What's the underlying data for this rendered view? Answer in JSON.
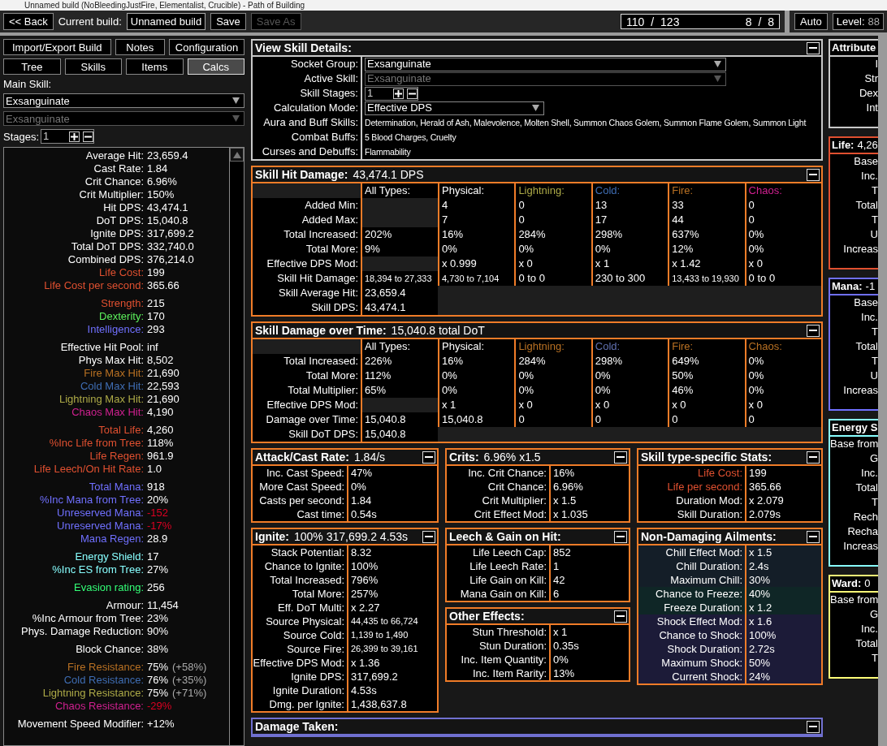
{
  "window": {
    "title": "Unnamed build (NoBleedingJustFire, Elementalist, Crucible) - Path of Building"
  },
  "top_bar": {
    "back": "<< Back",
    "current_build_label": "Current build:",
    "build_name": "Unnamed build",
    "save": "Save",
    "save_as": {
      "label": "Save As",
      "disabled": true
    },
    "points": "110 / 123",
    "ascendancy_points": "8 / 8",
    "auto": "Auto",
    "level_label": "Level:",
    "level": "88"
  },
  "left": {
    "buttons": [
      "Import/Export Build",
      "Notes",
      "Configuration"
    ],
    "tabs": [
      {
        "label": "Tree",
        "selected": false
      },
      {
        "label": "Skills",
        "selected": false
      },
      {
        "label": "Items",
        "selected": false
      },
      {
        "label": "Calcs",
        "selected": true
      }
    ],
    "main_skill_label": "Main Skill:",
    "selects": [
      {
        "value": "Exsanguinate",
        "disabled": false
      },
      {
        "value": "Exsanguinate",
        "disabled": true
      }
    ],
    "stages_label": "Stages:",
    "stages": "1",
    "stat_groups": [
      [
        {
          "label": "Average Hit:",
          "value": "23,659.4"
        },
        {
          "label": "Cast Rate:",
          "value": "1.84"
        },
        {
          "label": "Crit Chance:",
          "value": "6.96%"
        },
        {
          "label": "Crit Multiplier:",
          "value": "150%"
        },
        {
          "label": "Hit DPS:",
          "value": "43,474.1"
        },
        {
          "label": "DoT DPS:",
          "value": "15,040.8"
        },
        {
          "label": "Ignite DPS:",
          "value": "317,699.2"
        },
        {
          "label": "Total DoT DPS:",
          "value": "332,740.0"
        },
        {
          "label": "Combined DPS:",
          "value": "376,214.0"
        },
        {
          "label": "Life Cost:",
          "value": "199",
          "color": "#e05030"
        },
        {
          "label": "Life Cost per second:",
          "value": "365.66",
          "color": "#e05030"
        }
      ],
      [
        {
          "label": "Strength:",
          "value": "215",
          "color": "#e05030"
        },
        {
          "label": "Dexterity:",
          "value": "170",
          "color": "#5cf05c"
        },
        {
          "label": "Intelligence:",
          "value": "293",
          "color": "#7070ff"
        }
      ],
      [
        {
          "label": "Effective Hit Pool:",
          "value": "inf"
        },
        {
          "label": "Phys Max Hit:",
          "value": "8,502"
        },
        {
          "label": "Fire Max Hit:",
          "value": "21,690",
          "color": "#b97123"
        },
        {
          "label": "Cold Max Hit:",
          "value": "22,593",
          "color": "#3f6db3"
        },
        {
          "label": "Lightning Max Hit:",
          "value": "21,690",
          "color": "#adaa47"
        },
        {
          "label": "Chaos Max Hit:",
          "value": "4,190",
          "color": "#d02090"
        }
      ],
      [
        {
          "label": "Total Life:",
          "value": "4,260",
          "color": "#e05030"
        },
        {
          "label": "%Inc Life from Tree:",
          "value": "118%",
          "color": "#e05030"
        },
        {
          "label": "Life Regen:",
          "value": "961.9",
          "color": "#e05030"
        },
        {
          "label": "Life Leech/On Hit Rate:",
          "value": "1.0",
          "color": "#e05030"
        }
      ],
      [
        {
          "label": "Total Mana:",
          "value": "918",
          "color": "#7070ff"
        },
        {
          "label": "%Inc Mana from Tree:",
          "value": "20%",
          "color": "#7070ff"
        },
        {
          "label": "Unreserved Mana:",
          "value": {
            "text": "-152",
            "color": "#dc0022"
          },
          "color": "#7070ff"
        },
        {
          "label": "Unreserved Mana:",
          "value": {
            "text": "-17%",
            "color": "#dc0022"
          },
          "color": "#7070ff"
        },
        {
          "label": "Mana Regen:",
          "value": "28.9",
          "color": "#7070ff"
        }
      ],
      [
        {
          "label": "Energy Shield:",
          "value": "17",
          "color": "#88ffff"
        },
        {
          "label": "%Inc ES from Tree:",
          "value": "27%",
          "color": "#88ffff"
        }
      ],
      [
        {
          "label": "Evasion rating:",
          "value": "256",
          "color": "#33ff77"
        }
      ],
      [
        {
          "label": "Armour:",
          "value": "11,454"
        },
        {
          "label": "%Inc Armour from Tree:",
          "value": "23%"
        },
        {
          "label": "Phys. Damage Reduction:",
          "value": "90%"
        }
      ],
      [
        {
          "label": "Block Chance:",
          "value": "38%"
        }
      ],
      [
        {
          "label": "Fire Resistance:",
          "value": "75%",
          "extra": "(+58%)",
          "color": "#b97123"
        },
        {
          "label": "Cold Resistance:",
          "value": "76%",
          "extra": "(+35%)",
          "color": "#3f6db3"
        },
        {
          "label": "Lightning Resistance:",
          "value": "75%",
          "extra": "(+71%)",
          "color": "#adaa47"
        },
        {
          "label": "Chaos Resistance:",
          "value": {
            "text": "-29%",
            "color": "#dc0022"
          },
          "color": "#d02090"
        }
      ],
      [
        {
          "label": "Movement Speed Modifier:",
          "value": "+12%"
        }
      ]
    ]
  },
  "skill_details": {
    "title": "View Skill Details:",
    "color": "#c8c8c8",
    "rows": [
      {
        "label": "Socket Group:",
        "kind": "dropdown",
        "value": "Exsanguinate",
        "disabled": false
      },
      {
        "label": "Active Skill:",
        "kind": "dropdown",
        "value": "Exsanguinate",
        "disabled": true
      },
      {
        "label": "Skill Stages:",
        "kind": "stepper",
        "value": "1"
      },
      {
        "label": "Calculation Mode:",
        "kind": "select",
        "value": "Effective DPS"
      },
      {
        "label": "Aura and Buff Skills:",
        "kind": "text",
        "value": "Determination, Herald of Ash, Malevolence, Molten Shell, Summon Chaos Golem, Summon Flame Golem, Summon Light"
      },
      {
        "label": "Combat Buffs:",
        "kind": "text",
        "value": "5 Blood Charges, Cruelty"
      },
      {
        "label": "Curses and Debuffs:",
        "kind": "text",
        "value": "Flammability"
      }
    ]
  },
  "tables": [
    {
      "title": "Skill Hit Damage:",
      "summary": "43,474.1 DPS",
      "color": "#f07c28",
      "columns": [
        {
          "label": "All Types:",
          "color": "#ffffff"
        },
        {
          "label": "Physical:",
          "color": "#ffffff"
        },
        {
          "label": "Lightning:",
          "color": "#adaa47"
        },
        {
          "label": "Cold:",
          "color": "#3f6db3"
        },
        {
          "label": "Fire:",
          "color": "#b97123"
        },
        {
          "label": "Chaos:",
          "color": "#d02090"
        }
      ],
      "rows": [
        {
          "label": "Added Min:",
          "cells": [
            null,
            "4",
            "0",
            "13",
            "33",
            "0"
          ]
        },
        {
          "label": "Added Max:",
          "cells": [
            null,
            "7",
            "0",
            "17",
            "44",
            "0"
          ]
        },
        {
          "label": "Total Increased:",
          "cells": [
            "202%",
            "16%",
            "284%",
            "298%",
            "637%",
            "0%"
          ]
        },
        {
          "label": "Total More:",
          "cells": [
            "9%",
            "0%",
            "0%",
            "0%",
            "12%",
            "0%"
          ]
        },
        {
          "label": "Effective DPS Mod:",
          "cells": [
            null,
            "x 0.999",
            "x 0",
            "x 1",
            "x 1.42",
            "x 0"
          ]
        },
        {
          "label": "Skill Hit Damage:",
          "cells": [
            "18,394 to 27,333",
            "4,730 to 7,104",
            "0 to 0",
            "230 to 300",
            "13,433 to 19,930",
            "0 to 0"
          ]
        },
        {
          "label": "Skill Average Hit:",
          "cells": [
            "23,659.4"
          ]
        },
        {
          "label": "Skill DPS:",
          "cells": [
            "43,474.1"
          ]
        }
      ]
    },
    {
      "title": "Skill Damage over Time:",
      "summary": "15,040.8 total DoT",
      "color": "#f07c28",
      "columns": [
        {
          "label": "All Types:",
          "color": "#ffffff"
        },
        {
          "label": "Physical:",
          "color": "#ffffff"
        },
        {
          "label": "Lightning:",
          "color": "#b97123"
        },
        {
          "label": "Cold:",
          "color": "#6070b0"
        },
        {
          "label": "Fire:",
          "color": "#b97123"
        },
        {
          "label": "Chaos:",
          "color": "#b97123"
        }
      ],
      "rows": [
        {
          "label": "Total Increased:",
          "cells": [
            "226%",
            "16%",
            "284%",
            "298%",
            "649%",
            "0%"
          ]
        },
        {
          "label": "Total More:",
          "cells": [
            "112%",
            "0%",
            "0%",
            "0%",
            "50%",
            "0%"
          ]
        },
        {
          "label": "Total Multiplier:",
          "cells": [
            "65%",
            "0%",
            "0%",
            "0%",
            "46%",
            "0%"
          ]
        },
        {
          "label": "Effective DPS Mod:",
          "cells": [
            null,
            "x 1",
            "x 0",
            "x 0",
            "x 0",
            "x 0"
          ]
        },
        {
          "label": "Damage over Time:",
          "cells": [
            "15,040.8",
            "15,040.8",
            "0",
            "0",
            "0",
            "0"
          ]
        },
        {
          "label": "Skill DoT DPS:",
          "cells": [
            "15,040.8"
          ]
        }
      ]
    }
  ],
  "panel_columns": [
    [
      {
        "title": "Attack/Cast Rate:",
        "summary": "1.84/s",
        "color": "#f07c28",
        "rows": [
          {
            "label": "Inc. Cast Speed:",
            "value": "47%"
          },
          {
            "label": "More Cast Speed:",
            "value": "0%"
          },
          {
            "label": "Casts per second:",
            "value": "1.84"
          },
          {
            "label": "Cast time:",
            "value": "0.54s"
          }
        ]
      },
      {
        "title": "Ignite:",
        "summary": "100% 317,699.2 4.53s",
        "color": "#f07c28",
        "rows": [
          {
            "label": "Stack Potential:",
            "value": "8.32"
          },
          {
            "label": "Chance to Ignite:",
            "value": "100%"
          },
          {
            "label": "Total Increased:",
            "value": "796%"
          },
          {
            "label": "Total More:",
            "value": "257%"
          },
          {
            "label": "Eff. DoT Multi:",
            "value": "x 2.27"
          },
          {
            "label": "Source Physical:",
            "value": "44,435 to 66,724"
          },
          {
            "label": "Source Cold:",
            "value": "1,139 to 1,490"
          },
          {
            "label": "Source Fire:",
            "value": "26,399 to 39,161"
          },
          {
            "label": "Effective DPS Mod:",
            "value": "x 1.36"
          },
          {
            "label": "Ignite DPS:",
            "value": "317,699.2"
          },
          {
            "label": "Ignite Duration:",
            "value": "4.53s"
          },
          {
            "label": "Dmg. per Ignite:",
            "value": "1,438,637.8"
          }
        ]
      }
    ],
    [
      {
        "title": "Crits:",
        "summary": "6.96% x1.5",
        "color": "#f07c28",
        "rows": [
          {
            "label": "Inc. Crit Chance:",
            "value": "16%"
          },
          {
            "label": "Crit Chance:",
            "value": "6.96%"
          },
          {
            "label": "Crit Multiplier:",
            "value": "x 1.5"
          },
          {
            "label": "Crit Effect Mod:",
            "value": "x 1.035"
          }
        ]
      },
      {
        "title": "Leech & Gain on Hit:",
        "color": "#f07c28",
        "rows": [
          {
            "label": "Life Leech Cap:",
            "value": "852"
          },
          {
            "label": "Life Leech Rate:",
            "value": "1"
          },
          {
            "label": "Life Gain on Kill:",
            "value": "42"
          },
          {
            "label": "Mana Gain on Kill:",
            "value": "6"
          }
        ]
      },
      {
        "title": "Other Effects:",
        "color": "#f07c28",
        "rows": [
          {
            "label": "Stun Threshold:",
            "value": "x 1"
          },
          {
            "label": "Stun Duration:",
            "value": "0.35s"
          },
          {
            "label": "Inc. Item Quantity:",
            "value": "0%"
          },
          {
            "label": "Inc. Item Rarity:",
            "value": "13%"
          }
        ]
      }
    ],
    [
      {
        "title": "Skill type-specific Stats:",
        "color": "#f07c28",
        "rows": [
          {
            "label": "Life Cost:",
            "value": "199",
            "color": "#e05030"
          },
          {
            "label": "Life per second:",
            "value": "365.66",
            "color": "#e05030"
          },
          {
            "label": "Duration Mod:",
            "value": "x 2.079"
          },
          {
            "label": "Skill Duration:",
            "value": "2.079s"
          }
        ]
      },
      {
        "title": "Non-Damaging Ailments:",
        "color": "#f07c28",
        "rows": [
          {
            "label": "Chill Effect Mod:",
            "value": "x 1.5",
            "band": {
              "color": "#141e28"
            }
          },
          {
            "label": "Chill Duration:",
            "value": "2.4s",
            "band": {
              "color": "#141e28"
            }
          },
          {
            "label": "Maximum Chill:",
            "value": "30%",
            "band": {
              "color": "#141e28"
            }
          },
          {
            "label": "Chance to Freeze:",
            "value": "40%",
            "band": {
              "color": "#0f2626"
            }
          },
          {
            "label": "Freeze Duration:",
            "value": "x 1.2",
            "band": {
              "color": "#0f2626"
            }
          },
          {
            "label": "Shock Effect Mod:",
            "value": "x 1.6",
            "band": {
              "color": "#1c1b38"
            }
          },
          {
            "label": "Chance to Shock:",
            "value": "100%",
            "band": {
              "color": "#1c1b38"
            }
          },
          {
            "label": "Shock Duration:",
            "value": "2.72s",
            "band": {
              "color": "#1c1b38"
            }
          },
          {
            "label": "Maximum Shock:",
            "value": "50%",
            "band": {
              "color": "#1c1b38"
            }
          },
          {
            "label": "Current Shock:",
            "value": "24%",
            "band": {
              "color": "#1c1b38"
            }
          }
        ]
      }
    ]
  ],
  "damage_taken": {
    "title": "Damage Taken:",
    "color": "#7070d0"
  },
  "side_panels": [
    {
      "title": "Attribute",
      "color": "#c8c8c8",
      "rows": [
        "I",
        "Str",
        "Dex",
        "Int"
      ]
    },
    {
      "title": "Life:",
      "value": "4,26",
      "color": "#e05030",
      "rows": [
        "Base",
        "Inc.",
        "T",
        "Total",
        "T",
        "U",
        "Increas"
      ]
    },
    {
      "title": "Mana:",
      "value": "-1",
      "color": "#7070ff",
      "rows": [
        "Base",
        "Inc.",
        "T",
        "Total",
        "T",
        "U",
        "Increas"
      ]
    },
    {
      "title": "Energy S",
      "color": "#88ffff",
      "rows": [
        "Base from",
        "G",
        "Inc.",
        "Total",
        "T",
        "Rech",
        "Recha",
        "Increas"
      ]
    },
    {
      "title": "Ward:",
      "value": "0",
      "color": "#ffff77",
      "rows": [
        "Base from",
        "G",
        "Inc.",
        "Total",
        "T"
      ]
    }
  ]
}
